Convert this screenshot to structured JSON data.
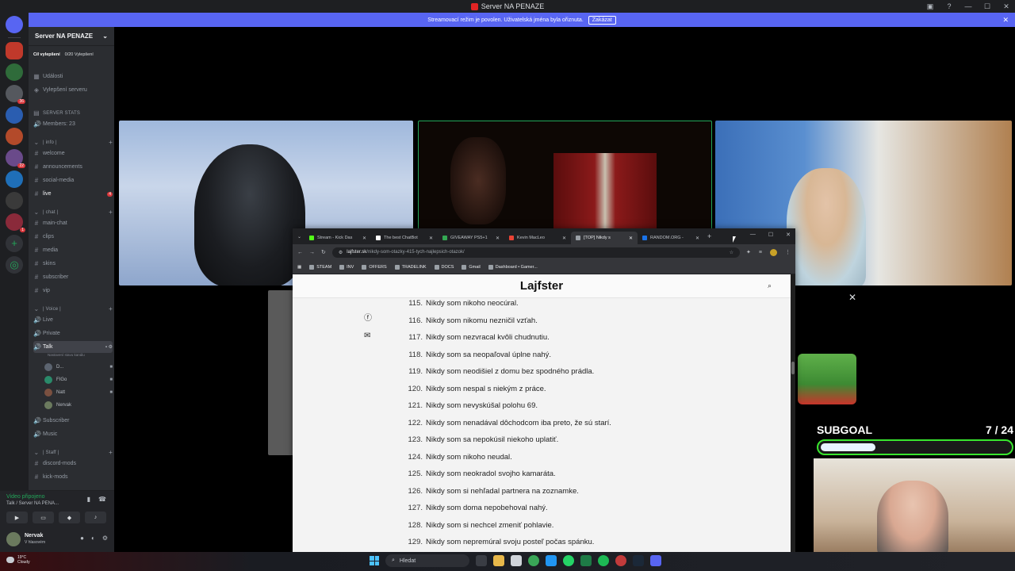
{
  "titlebar": {
    "title": "Server NA PENAZE"
  },
  "notice": {
    "text": "Streamovací režim je povolen. Uživatelská jména byla ořiznuta.",
    "button": "Zakázat"
  },
  "server": {
    "name": "Server NA PENAZE",
    "boost_label": "Cíl vylepšení",
    "boost_progress": "0/20 Vylepšení",
    "events": "Události",
    "upgrades": "Vylepšení serveru"
  },
  "channels": {
    "stats_cat": "SERVER STATS",
    "members": "Members: 23",
    "info_cat": "| info |",
    "welcome": "welcome",
    "announcements": "announcements",
    "social_media": "social-media",
    "live": "live",
    "live_badge": "4",
    "chat_cat": "| chat |",
    "main_chat": "main-chat",
    "clips": "clips",
    "media": "media",
    "skins": "skins",
    "subscriber": "subscriber",
    "vip": "vip",
    "voice_cat": "| Voice |",
    "v_live": "Live",
    "v_private": "Private",
    "v_talk": "Talk",
    "v_talk_note": "Nastavení stavu kanálu",
    "m1": "D...",
    "m2": "FIGo",
    "m3": "Natt",
    "m4": "Nervak",
    "v_subscriber": "Subscriber",
    "v_music": "Music",
    "staff_cat": "| Staff |",
    "discord_mods": "discord-mods",
    "kick_mods": "kick-mods"
  },
  "voice": {
    "status": "Video připojeno",
    "location": "Talk / Server NA PENA..."
  },
  "user": {
    "name": "Nervak",
    "status": "V hlasovém"
  },
  "rail_badges": [
    "36",
    "22",
    "1"
  ],
  "stage": {
    "subgoal_label": "SUBGOAL",
    "subgoal_count": "7 / 24",
    "subgoal_progress": 0.29
  },
  "browser": {
    "tabs": [
      {
        "label": "Stream - Kick Das",
        "color": "#53fc18"
      },
      {
        "label": "The best ChatBot",
        "color": "#ffffff"
      },
      {
        "label": "GIVEAWAY PS5+1",
        "color": "#34a853"
      },
      {
        "label": "Kevin MacLeo",
        "color": "#ea4335"
      },
      {
        "label": "[TOP] Nikdy s",
        "color": "#9aa0a6"
      },
      {
        "label": "RANDOM.ORG -",
        "color": "#1a73e8"
      }
    ],
    "url_domain": "lajfster.sk",
    "url_path": "/nikdy-som-otazky-415-tych-najlepsich-otazok/",
    "bookmarks": [
      "STEAM",
      "INV",
      "OFFERS",
      "TRADELINK",
      "DOCS",
      "Gmail",
      "Dashboard • Gamer..."
    ],
    "site_logo": "Lajfster",
    "items": [
      {
        "n": "115.",
        "t": "Nikdy som nikoho neocúral."
      },
      {
        "n": "116.",
        "t": "Nikdy som nikomu nezničil vzťah."
      },
      {
        "n": "117.",
        "t": "Nikdy som nezvracal kvôli chudnutiu."
      },
      {
        "n": "118.",
        "t": "Nikdy som sa neopaľoval úplne nahý."
      },
      {
        "n": "119.",
        "t": "Nikdy som neodišiel z domu bez spodného prádla."
      },
      {
        "n": "120.",
        "t": "Nikdy som nespal s niekým z práce."
      },
      {
        "n": "121.",
        "t": "Nikdy som nevyskúšal polohu 69."
      },
      {
        "n": "122.",
        "t": "Nikdy som nenadával dôchodcom iba preto, že sú starí."
      },
      {
        "n": "123.",
        "t": "Nikdy som sa nepokúsil niekoho uplatiť."
      },
      {
        "n": "124.",
        "t": "Nikdy som nikoho neudal."
      },
      {
        "n": "125.",
        "t": "Nikdy som neokradol svojho kamaráta."
      },
      {
        "n": "126.",
        "t": "Nikdy som si nehľadal partnera na zoznamke."
      },
      {
        "n": "127.",
        "t": "Nikdy som doma nepobehoval nahý."
      },
      {
        "n": "128.",
        "t": "Nikdy som si nechcel zmeniť pohlavie."
      },
      {
        "n": "129.",
        "t": "Nikdy som nepremúral svoju posteľ počas spánku."
      }
    ]
  },
  "taskbar": {
    "temp": "19°C",
    "weather": "Cloudy",
    "search": "Hledat"
  },
  "colors": {
    "discord_blurple": "#5865f2",
    "sidebar": "#2b2d31",
    "subgoal_green": "#39e62e"
  }
}
